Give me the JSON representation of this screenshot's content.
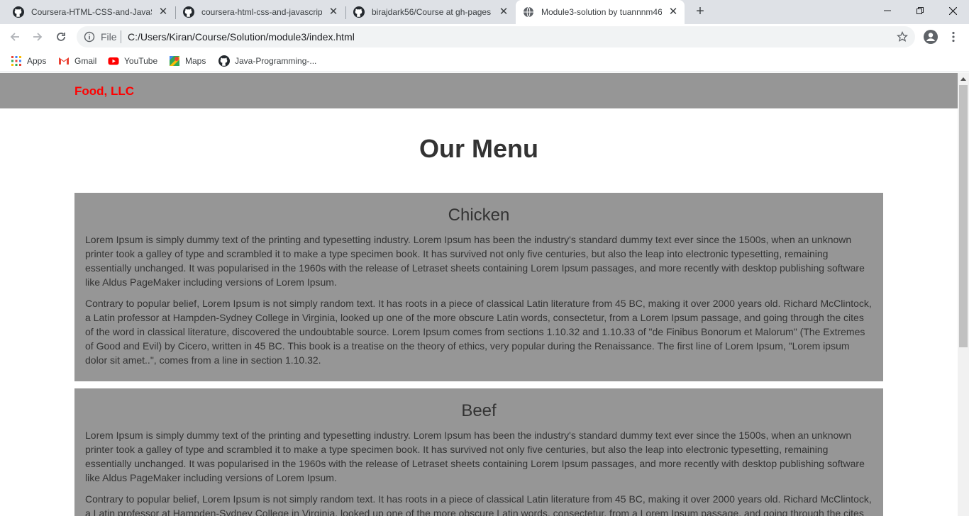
{
  "browser": {
    "tabs": [
      {
        "title": "Coursera-HTML-CSS-and-JavaScript",
        "icon": "github-icon"
      },
      {
        "title": "coursera-html-css-and-javascript",
        "icon": "github-icon"
      },
      {
        "title": "birajdark56/Course at gh-pages",
        "icon": "github-icon"
      },
      {
        "title": "Module3-solution by tuannnm46",
        "icon": "globe-icon",
        "active": true
      }
    ],
    "new_tab": "+",
    "address_scheme": "File",
    "address_url": "C:/Users/Kiran/Course/Solution/module3/index.html",
    "bookmarks": [
      {
        "label": "Apps",
        "icon": "apps-grid-icon"
      },
      {
        "label": "Gmail",
        "icon": "gmail-icon"
      },
      {
        "label": "YouTube",
        "icon": "youtube-icon"
      },
      {
        "label": "Maps",
        "icon": "maps-icon"
      },
      {
        "label": "Java-Programming-...",
        "icon": "github-icon"
      }
    ]
  },
  "page": {
    "brand": "Food, LLC",
    "heading": "Our Menu",
    "sections": [
      {
        "title": "Chicken",
        "paragraphs": [
          "Lorem Ipsum is simply dummy text of the printing and typesetting industry. Lorem Ipsum has been the industry's standard dummy text ever since the 1500s, when an unknown printer took a galley of type and scrambled it to make a type specimen book. It has survived not only five centuries, but also the leap into electronic typesetting, remaining essentially unchanged. It was popularised in the 1960s with the release of Letraset sheets containing Lorem Ipsum passages, and more recently with desktop publishing software like Aldus PageMaker including versions of Lorem Ipsum.",
          "Contrary to popular belief, Lorem Ipsum is not simply random text. It has roots in a piece of classical Latin literature from 45 BC, making it over 2000 years old. Richard McClintock, a Latin professor at Hampden-Sydney College in Virginia, looked up one of the more obscure Latin words, consectetur, from a Lorem Ipsum passage, and going through the cites of the word in classical literature, discovered the undoubtable source. Lorem Ipsum comes from sections 1.10.32 and 1.10.33 of \"de Finibus Bonorum et Malorum\" (The Extremes of Good and Evil) by Cicero, written in 45 BC. This book is a treatise on the theory of ethics, very popular during the Renaissance. The first line of Lorem Ipsum, \"Lorem ipsum dolor sit amet..\", comes from a line in section 1.10.32."
        ]
      },
      {
        "title": "Beef",
        "paragraphs": [
          "Lorem Ipsum is simply dummy text of the printing and typesetting industry. Lorem Ipsum has been the industry's standard dummy text ever since the 1500s, when an unknown printer took a galley of type and scrambled it to make a type specimen book. It has survived not only five centuries, but also the leap into electronic typesetting, remaining essentially unchanged. It was popularised in the 1960s with the release of Letraset sheets containing Lorem Ipsum passages, and more recently with desktop publishing software like Aldus PageMaker including versions of Lorem Ipsum.",
          "Contrary to popular belief, Lorem Ipsum is not simply random text. It has roots in a piece of classical Latin literature from 45 BC, making it over 2000 years old. Richard McClintock, a Latin professor at Hampden-Sydney College in Virginia, looked up one of the more obscure Latin words, consectetur, from a Lorem Ipsum passage, and going through the cites"
        ]
      }
    ],
    "colors": {
      "header_bg": "#969696",
      "brand": "#ff0000",
      "section_bg": "#969696",
      "text": "#333333"
    }
  }
}
